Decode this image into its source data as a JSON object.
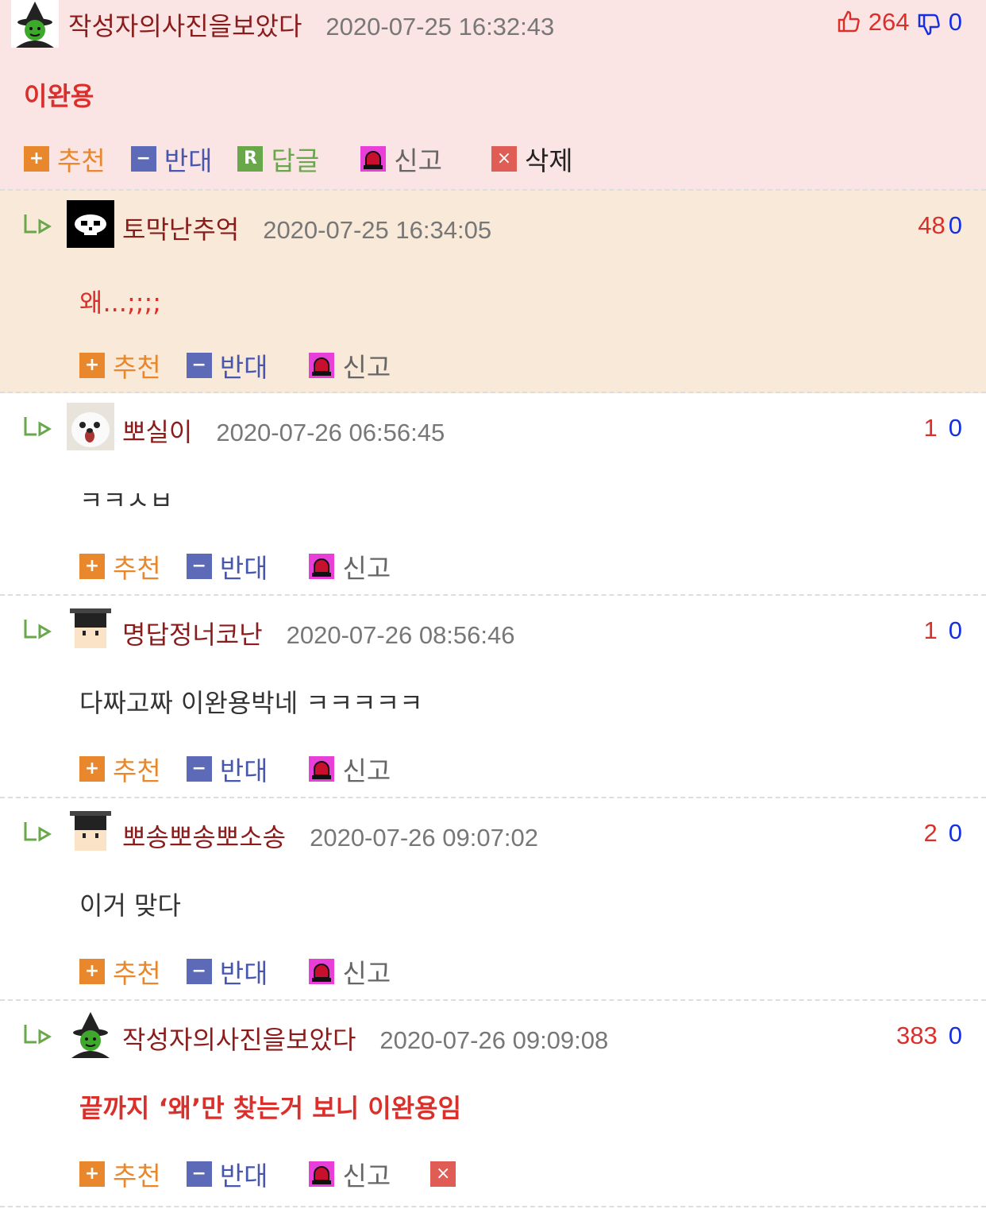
{
  "comments": [
    {
      "kind": "top",
      "nickname": "작성자의사진을보았다",
      "date": "2020-07-25 16:32:43",
      "up": "264",
      "down": "0",
      "content": "이완용",
      "actions": {
        "recommend": "추천",
        "oppose": "반대",
        "reply": "답글",
        "report": "신고",
        "delete": "삭제"
      }
    },
    {
      "kind": "reply",
      "nickname": "토막난추억",
      "date": "2020-07-25 16:34:05",
      "up": "48",
      "down": "0",
      "content": "왜...;;;;",
      "actions": {
        "recommend": "추천",
        "oppose": "반대",
        "report": "신고"
      }
    },
    {
      "kind": "reply",
      "nickname": "뽀실이",
      "date": "2020-07-26 06:56:45",
      "up": "1",
      "down": "0",
      "content": "ㅋㅋㅅㅂ",
      "actions": {
        "recommend": "추천",
        "oppose": "반대",
        "report": "신고"
      }
    },
    {
      "kind": "reply",
      "nickname": "명답정너코난",
      "date": "2020-07-26 08:56:46",
      "up": "1",
      "down": "0",
      "content": "다짜고짜 이완용박네 ㅋㅋㅋㅋㅋ",
      "actions": {
        "recommend": "추천",
        "oppose": "반대",
        "report": "신고"
      }
    },
    {
      "kind": "reply",
      "nickname": "뽀송뽀송뽀소송",
      "date": "2020-07-26 09:07:02",
      "up": "2",
      "down": "0",
      "content": "이거 맞다",
      "actions": {
        "recommend": "추천",
        "oppose": "반대",
        "report": "신고"
      }
    },
    {
      "kind": "reply",
      "nickname": "작성자의사진을보았다",
      "date": "2020-07-26 09:09:08",
      "up": "383",
      "down": "0",
      "content": "끝까지 ‘왜’만 찾는거 보니 이완용임",
      "actions": {
        "recommend": "추천",
        "oppose": "반대",
        "report": "신고"
      }
    }
  ],
  "icons": {
    "thumbs_up": "thumbs-up-icon",
    "thumbs_down": "thumbs-down-icon",
    "reply_arrow": "reply-arrow-icon",
    "plus": "plus-icon",
    "minus": "minus-icon",
    "reply": "reply-r-icon",
    "report": "siren-icon",
    "delete": "close-icon"
  },
  "colors": {
    "top_bg": "#fae4e4",
    "highlight_bg": "#f9e9d9",
    "up": "#d9302c",
    "down": "#1530e0",
    "nickname": "#8a1c1c",
    "recommend": "#e8872c",
    "oppose": "#5d6ab8",
    "reply": "#68a84a",
    "report": "#e83fd9",
    "delete": "#e05d56"
  }
}
